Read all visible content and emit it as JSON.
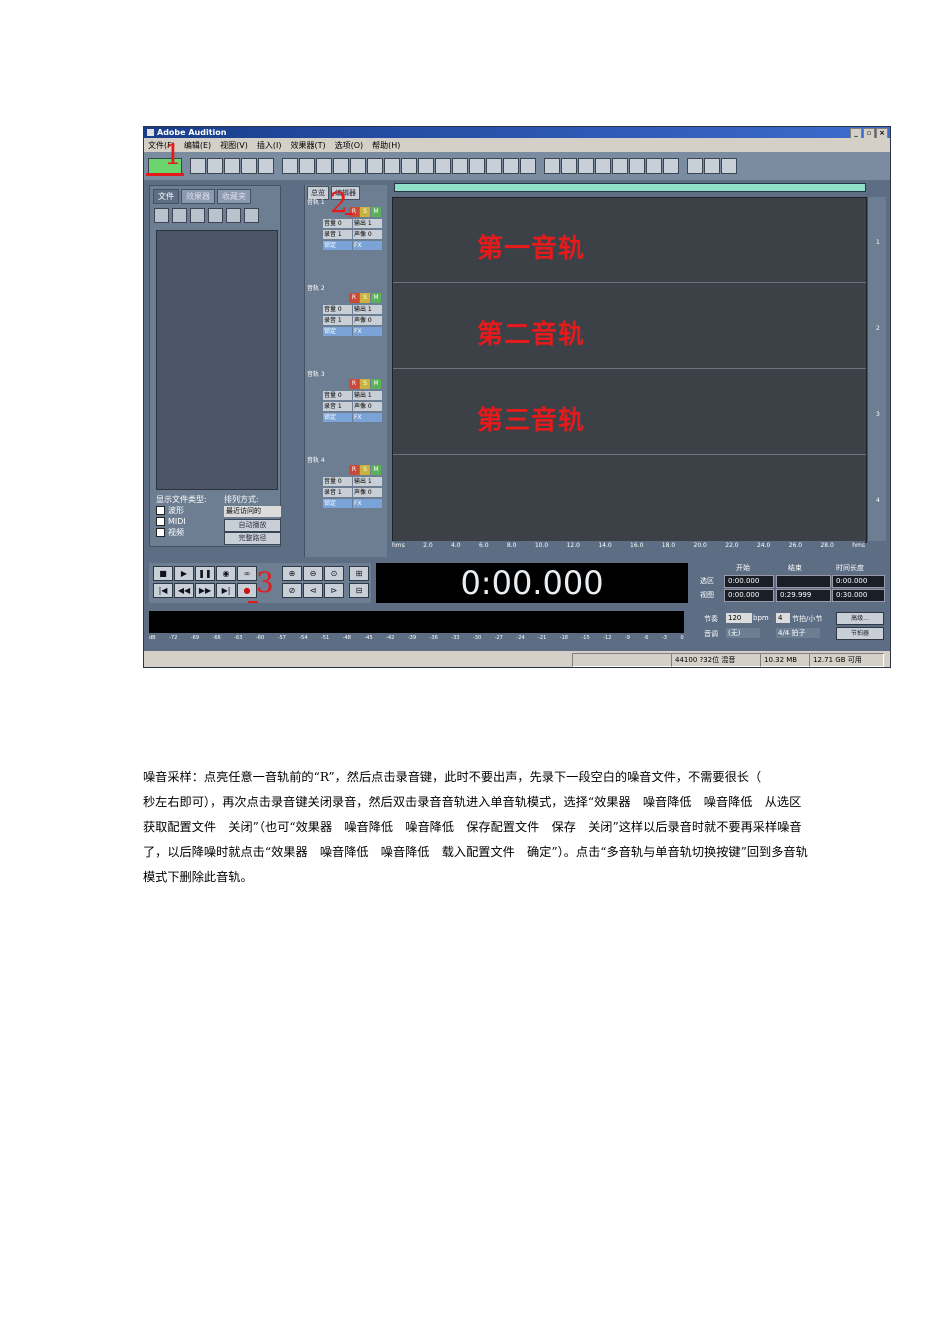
{
  "app": {
    "title": "Adobe Audition",
    "window_controls": [
      "_",
      "▫",
      "×"
    ],
    "menu": [
      "文件(F)",
      "编辑(E)",
      "视图(V)",
      "插入(I)",
      "效果器(T)",
      "选项(O)",
      "帮助(H)"
    ]
  },
  "organizer": {
    "tabs": [
      "文件",
      "效果器",
      "收藏夹"
    ],
    "show_types_label": "显示文件类型:",
    "sort_label": "排列方式:",
    "sort_value": "最近访问的",
    "types": [
      "波形",
      "MIDI",
      "视频"
    ],
    "auto_play_label": "自动播放",
    "full_path_label": "完整路径"
  },
  "track_panel": {
    "tabs": [
      "总览",
      "编辑器"
    ],
    "tracks": [
      {
        "name": "音轨 1",
        "volume": "音量 0",
        "output": "输出 1",
        "record": "录音 1",
        "pan": "声像 0",
        "lock": "锁定",
        "fx": "FX"
      },
      {
        "name": "音轨 2",
        "volume": "音量 0",
        "output": "输出 1",
        "record": "录音 1",
        "pan": "声像 0",
        "lock": "锁定",
        "fx": "FX"
      },
      {
        "name": "音轨 3",
        "volume": "音量 0",
        "output": "输出 1",
        "record": "录音 1",
        "pan": "声像 0",
        "lock": "锁定",
        "fx": "FX"
      },
      {
        "name": "音轨 4",
        "volume": "音量 0",
        "output": "输出 1",
        "record": "录音 1",
        "pan": "声像 0",
        "lock": "锁定",
        "fx": "FX"
      }
    ],
    "rsm": [
      "R",
      "S",
      "M"
    ]
  },
  "lanes": {
    "labels": [
      "第一音轨",
      "第二音轨",
      "第三音轨",
      ""
    ],
    "numbers": [
      "1",
      "2",
      "3",
      "4"
    ]
  },
  "ruler": [
    "hms",
    "2.0",
    "4.0",
    "6.0",
    "8.0",
    "10.0",
    "12.0",
    "14.0",
    "16.0",
    "18.0",
    "20.0",
    "22.0",
    "24.0",
    "26.0",
    "28.0",
    "hms"
  ],
  "time": {
    "display": "0:00.000",
    "headers": [
      "开始",
      "结束",
      "时间长度"
    ],
    "row_labels": [
      "选区",
      "视图"
    ],
    "selection": [
      "0:00.000",
      "",
      "0:00.000"
    ],
    "view": [
      "0:00.000",
      "0:29.999",
      "0:30.000"
    ]
  },
  "meter_scale": [
    "dB",
    "-72",
    "-69",
    "-66",
    "-63",
    "-60",
    "-57",
    "-54",
    "-51",
    "-48",
    "-45",
    "-42",
    "-39",
    "-36",
    "-33",
    "-30",
    "-27",
    "-24",
    "-21",
    "-18",
    "-15",
    "-12",
    "-9",
    "-6",
    "-3",
    "0"
  ],
  "tempo": {
    "tempo_label": "节奏",
    "tempo_value": "120",
    "bpm": "bpm",
    "beats_value": "4",
    "beats_label": "节拍/小节",
    "advanced_label": "高级...",
    "key_label": "音调",
    "key_value": "(无)",
    "meter_value": "4/4 拍子",
    "metronome_label": "节拍器"
  },
  "status": {
    "format": "44100 ?32位 混音",
    "size": "10.32 MB",
    "free": "12.71 GB 可用"
  },
  "annotations": [
    "1",
    "2",
    "3"
  ],
  "paragraph": "噪音采样：点亮任意一音轨前的“R”，然后点击录音键，此时不要出声，先录下一段空白的噪音文件，不需要很长（　　　秒左右即可），再次点击录音键关闭录音，然后双击录音音轨进入单音轨模式，选择“效果器　噪音降低　噪音降低　从选区获取配置文件　关闭”（也可“效果器　噪音降低　噪音降低　保存配置文件　保存　关闭”这样以后录音时就不要再采样噪音了，以后降噪时就点击“效果器　噪音降低　噪音降低　载入配置文件　确定”）。点击“多音轨与单音轨切换按键”回到多音轨模式下删除此音轨。"
}
